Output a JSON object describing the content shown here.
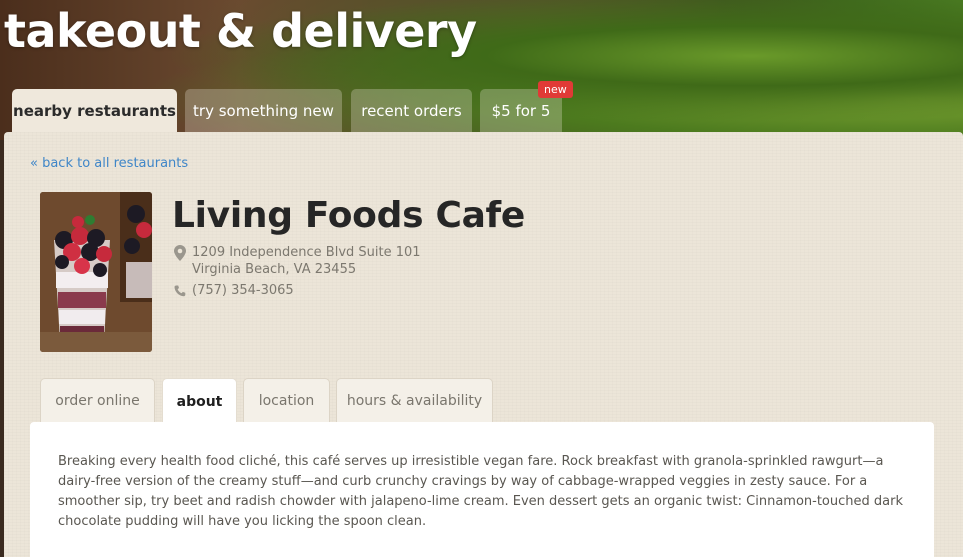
{
  "hero": {
    "title": "takeout & delivery"
  },
  "top_tabs": [
    {
      "label": "nearby restaurants",
      "active": true
    },
    {
      "label": "try something new",
      "active": false
    },
    {
      "label": "recent orders",
      "active": false
    },
    {
      "label": "$5 for 5",
      "active": false,
      "badge": "new"
    }
  ],
  "back_link": "« back to all restaurants",
  "restaurant": {
    "name": "Living Foods Cafe",
    "address_line1": "1209 Independence Blvd Suite 101",
    "address_line2": "Virginia Beach, VA 23455",
    "phone": "(757) 354-3065",
    "photo_icon": "berry-parfait-photo"
  },
  "sub_tabs": [
    {
      "label": "order online",
      "active": false
    },
    {
      "label": "about",
      "active": true
    },
    {
      "label": "location",
      "active": false
    },
    {
      "label": "hours & availability",
      "active": false
    }
  ],
  "about": {
    "description": "Breaking every health food cliché, this café serves up irresistible vegan fare. Rock breakfast with granola-sprinkled rawgurt—a dairy-free version of the creamy stuff—and curb crunchy cravings by way of cabbage-wrapped veggies in zesty sauce. For a smoother sip, try beet and radish chowder with jalapeno-lime cream. Even dessert gets an organic twist: Cinnamon-touched dark chocolate pudding will have you licking the spoon clean."
  },
  "colors": {
    "accent_link": "#3f86c8",
    "badge_red": "#e03a36",
    "panel_bg": "#ece5d8"
  }
}
